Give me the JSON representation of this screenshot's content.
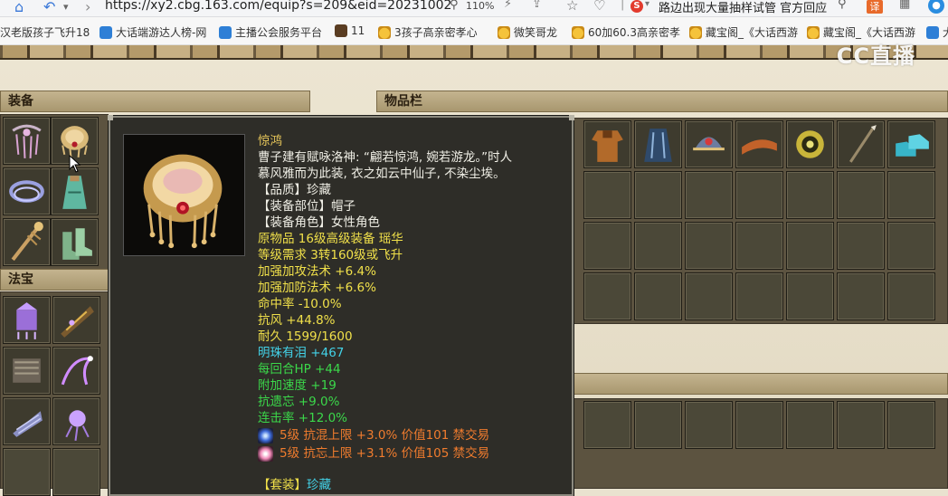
{
  "browser": {
    "url": "https://xy2.cbg.163.com/equip?s=209&eid=20231002",
    "zoom": "110%",
    "search_query": "路边出现大量抽样试管 官方回应",
    "translate_label": "译",
    "engine_label": "S",
    "cast_logo": "CC直播"
  },
  "bookmarks": [
    {
      "label": "汉老版孩子飞升18",
      "icon": "none"
    },
    {
      "label": "大话端游达人榜-网",
      "icon": "blue-eye"
    },
    {
      "label": "主播公会服务平台",
      "icon": "blue-globe"
    },
    {
      "label": "11",
      "icon": "game-icon"
    },
    {
      "label": "3孩子高亲密孝心",
      "icon": "chick"
    },
    {
      "label": "微笑哥龙",
      "icon": "chick"
    },
    {
      "label": "60加60.3高亲密孝",
      "icon": "chick"
    },
    {
      "label": "藏宝阁_《大话西游",
      "icon": "chick"
    },
    {
      "label": "藏宝阁_《大话西游",
      "icon": "chick"
    },
    {
      "label": "大",
      "icon": "globe"
    }
  ],
  "panels": {
    "equip_title": "装备",
    "treasure_title": "法宝",
    "inventory_title": "物品栏"
  },
  "tooltip": {
    "name": "惊鸿",
    "desc_line1": "曹子建有赋咏洛神: “翩若惊鸿, 婉若游龙。”时人",
    "desc_line2": "慕风雅而为此装, 衣之如云中仙子, 不染尘埃。",
    "quality": "【品质】珍藏",
    "slot": "【装备部位】帽子",
    "role": "【装备角色】女性角色",
    "origin": "原物品 16级高级装备 瑶华",
    "requirement": "等级需求 3转160级或飞升",
    "stats_yellow": [
      "加强加攻法术 +6.4%",
      "加强加防法术 +6.6%",
      "命中率 -10.0%",
      "抗风 +44.8%",
      "耐久 1599/1600"
    ],
    "gem_stat": "明珠有泪 +467",
    "stats_green": [
      "每回合HP +44",
      "附加速度 +19",
      "抗遗忘 +9.0%",
      "连击率 +12.0%"
    ],
    "runes": [
      {
        "text": "5级 抗混上限 +3.0% 价值101 禁交易",
        "gem": "blue"
      },
      {
        "text": "5级 抗忘上限 +3.1% 价值105 禁交易",
        "gem": "pink"
      }
    ],
    "set_label": "【套装】",
    "set_value": "珍藏"
  },
  "colors": {
    "tooltip_bg": "#2e2d28",
    "title_gold": "#e8c75a",
    "stat_yellow": "#f0e04a",
    "stat_cyan": "#43d2e8",
    "stat_green": "#3bd84a",
    "rune_orange": "#f07c2e"
  }
}
